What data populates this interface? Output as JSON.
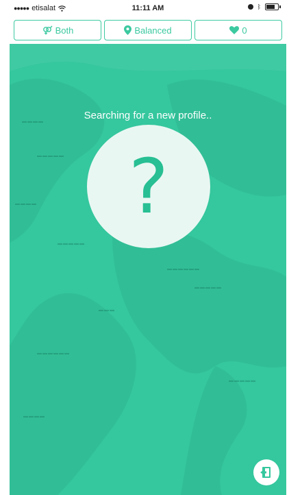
{
  "status_bar": {
    "carrier": "etisalat",
    "time": "11:11 AM"
  },
  "filters": {
    "gender_label": "Both",
    "mode_label": "Balanced",
    "likes_count": "0"
  },
  "main": {
    "search_message": "Searching for a new profile..",
    "placeholder_symbol": "?"
  },
  "colors": {
    "accent": "#3cc9a0",
    "background": "#35c79e",
    "circle": "#e9f7f2"
  },
  "icons": {
    "gender": "gender-both-icon",
    "mode": "map-pin-icon",
    "likes": "heart-icon",
    "exit": "exit-door-icon"
  }
}
